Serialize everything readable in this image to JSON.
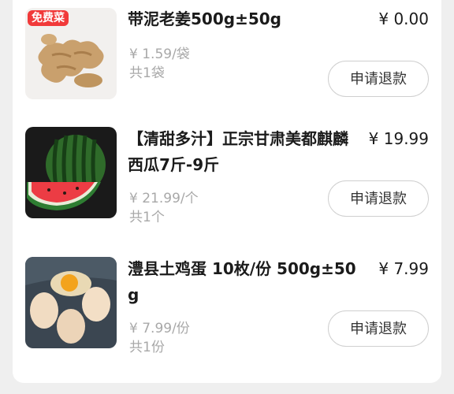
{
  "orders": [
    {
      "badge": "免费菜",
      "title": "带泥老姜500g±50g",
      "price": "¥ 0.00",
      "unit_price": "¥ 1.59/袋",
      "quantity": "共1袋",
      "refund_label": "申请退款",
      "image_icon": "ginger-image"
    },
    {
      "title": "【清甜多汁】正宗甘肃美都麒麟西瓜7斤-9斤",
      "price": "¥ 19.99",
      "unit_price": "¥ 21.99/个",
      "quantity": "共1个",
      "refund_label": "申请退款",
      "image_icon": "watermelon-image"
    },
    {
      "title": "澧县土鸡蛋 10枚/份 500g±50g",
      "price": "¥ 7.99",
      "unit_price": "¥ 7.99/份",
      "quantity": "共1份",
      "refund_label": "申请退款",
      "image_icon": "eggs-image"
    }
  ],
  "colors": {
    "badge": "#f13a3a",
    "muted_text": "#a8a8a8",
    "page_background": "#efefef"
  }
}
